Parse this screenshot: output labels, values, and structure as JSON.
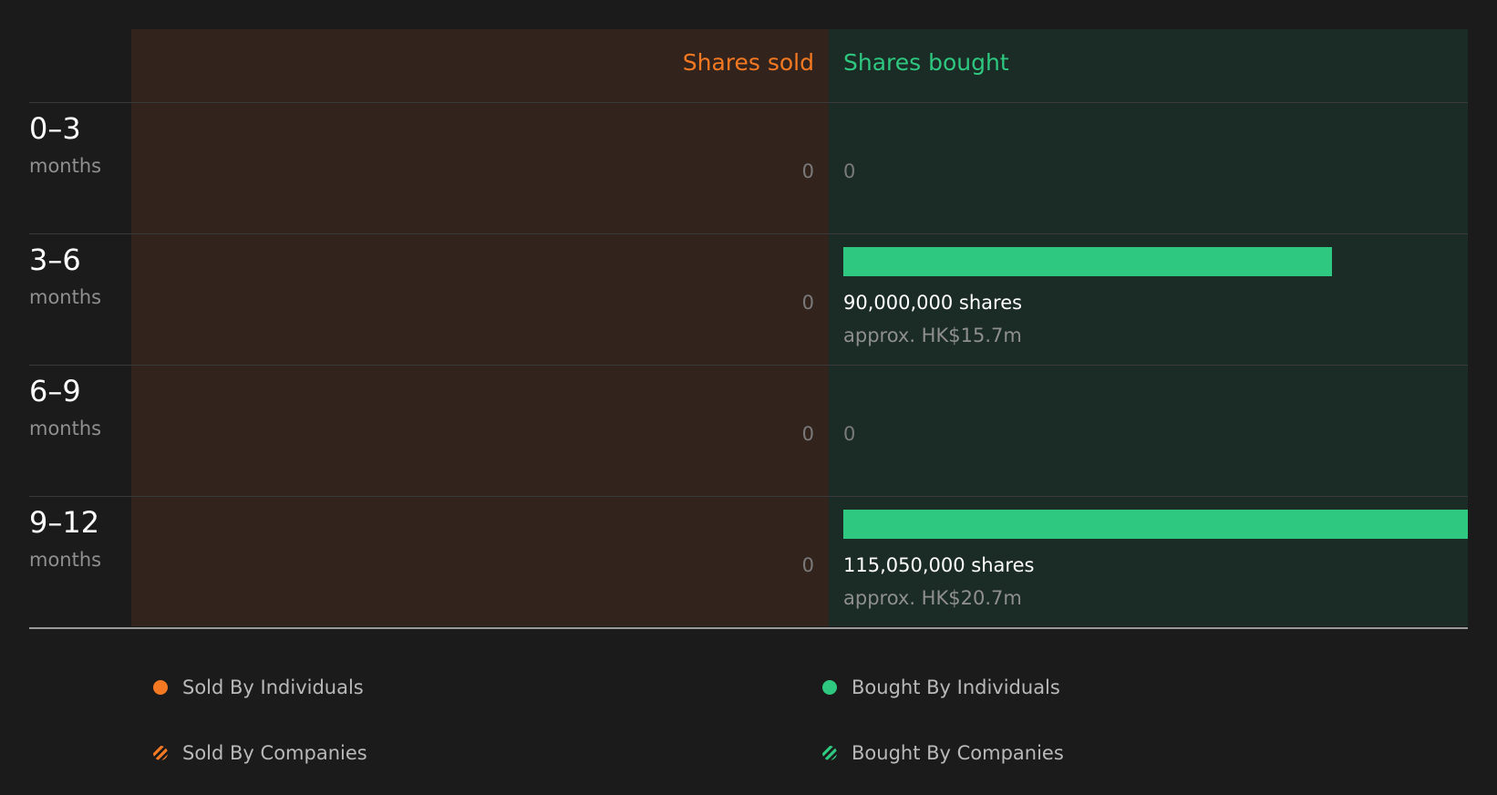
{
  "chart_data": {
    "type": "bar",
    "headers": {
      "sold": "Shares sold",
      "bought": "Shares bought"
    },
    "rows": [
      {
        "period": "0–3",
        "unit": "months",
        "sold": 0,
        "sold_label": "0",
        "bought": 0,
        "bought_label": "0",
        "bought_value": ""
      },
      {
        "period": "3–6",
        "unit": "months",
        "sold": 0,
        "sold_label": "0",
        "bought": 90000000,
        "bought_label": "90,000,000 shares",
        "bought_value": "approx. HK$15.7m"
      },
      {
        "period": "6–9",
        "unit": "months",
        "sold": 0,
        "sold_label": "0",
        "bought": 0,
        "bought_label": "0",
        "bought_value": ""
      },
      {
        "period": "9–12",
        "unit": "months",
        "sold": 0,
        "sold_label": "0",
        "bought": 115050000,
        "bought_label": "115,050,000 shares",
        "bought_value": "approx. HK$20.7m"
      }
    ],
    "legend": [
      {
        "label": "Sold By Individuals",
        "color": "#f57923",
        "style": "solid"
      },
      {
        "label": "Sold By Companies",
        "color": "#f57923",
        "style": "hatched"
      },
      {
        "label": "Bought By Individuals",
        "color": "#2ec880",
        "style": "solid"
      },
      {
        "label": "Bought By Companies",
        "color": "#2ec880",
        "style": "hatched"
      }
    ],
    "colors": {
      "sold": "#f57923",
      "bought": "#2ec880"
    }
  }
}
